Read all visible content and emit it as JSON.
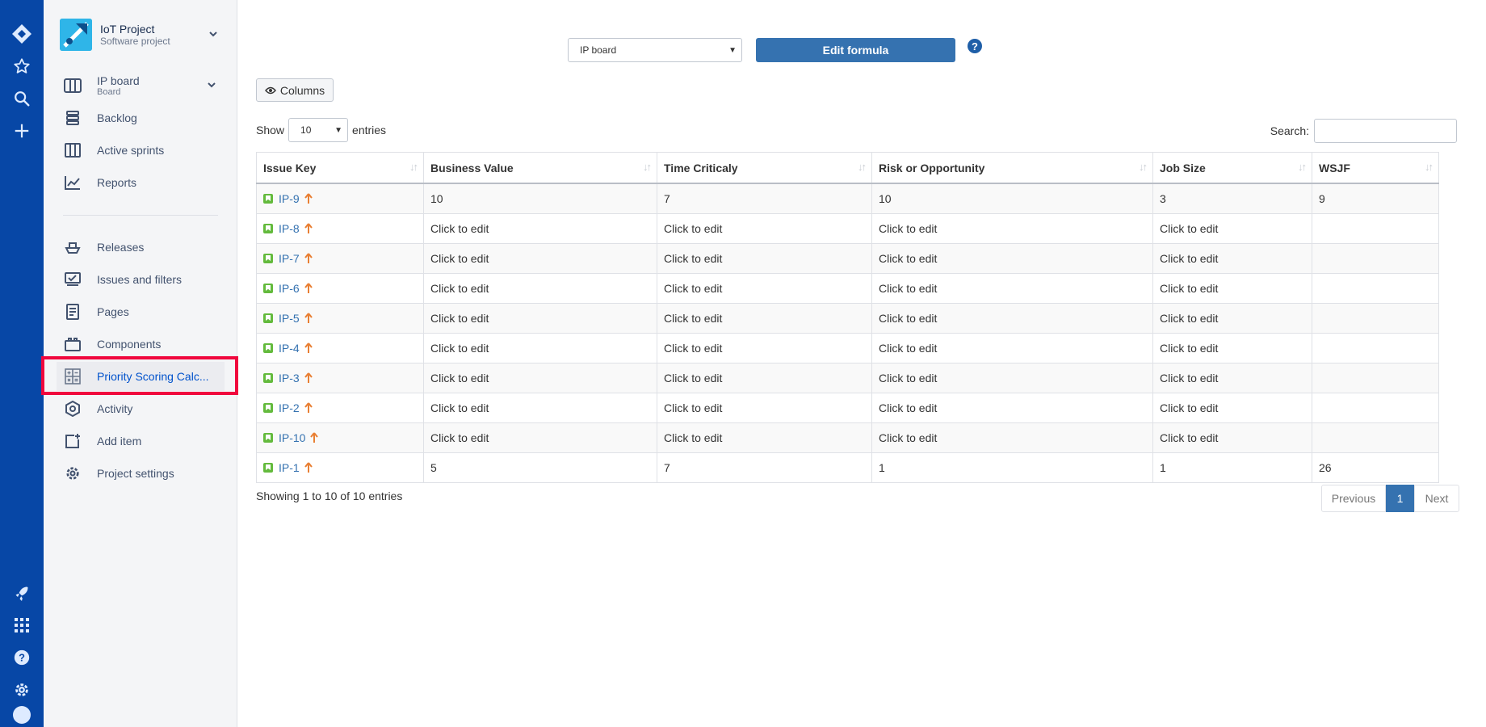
{
  "project": {
    "name": "IoT Project",
    "type": "Software project"
  },
  "sidebar": {
    "board": {
      "label": "IP board",
      "sub": "Board"
    },
    "planning": [
      {
        "label": "Backlog"
      },
      {
        "label": "Active sprints"
      },
      {
        "label": "Reports"
      }
    ],
    "items": [
      {
        "label": "Releases"
      },
      {
        "label": "Issues and filters"
      },
      {
        "label": "Pages"
      },
      {
        "label": "Components"
      },
      {
        "label": "Priority Scoring Calc..."
      },
      {
        "label": "Activity"
      },
      {
        "label": "Add item"
      },
      {
        "label": "Project settings"
      }
    ]
  },
  "toolbar": {
    "board_select": "IP board",
    "edit_formula": "Edit formula",
    "help": "?",
    "columns": "Columns"
  },
  "table_controls": {
    "show": "Show",
    "page_length": "10",
    "entries": "entries",
    "search_label": "Search:"
  },
  "table": {
    "headers": [
      "Issue Key",
      "Business Value",
      "Time Criticaly",
      "Risk or Opportunity",
      "Job Size",
      "WSJF"
    ],
    "rows": [
      {
        "key": "IP-9",
        "bv": "10",
        "tc": "7",
        "ro": "10",
        "js": "3",
        "wsjf": "9"
      },
      {
        "key": "IP-8",
        "bv": "Click to edit",
        "tc": "Click to edit",
        "ro": "Click to edit",
        "js": "Click to edit",
        "wsjf": ""
      },
      {
        "key": "IP-7",
        "bv": "Click to edit",
        "tc": "Click to edit",
        "ro": "Click to edit",
        "js": "Click to edit",
        "wsjf": ""
      },
      {
        "key": "IP-6",
        "bv": "Click to edit",
        "tc": "Click to edit",
        "ro": "Click to edit",
        "js": "Click to edit",
        "wsjf": ""
      },
      {
        "key": "IP-5",
        "bv": "Click to edit",
        "tc": "Click to edit",
        "ro": "Click to edit",
        "js": "Click to edit",
        "wsjf": ""
      },
      {
        "key": "IP-4",
        "bv": "Click to edit",
        "tc": "Click to edit",
        "ro": "Click to edit",
        "js": "Click to edit",
        "wsjf": ""
      },
      {
        "key": "IP-3",
        "bv": "Click to edit",
        "tc": "Click to edit",
        "ro": "Click to edit",
        "js": "Click to edit",
        "wsjf": ""
      },
      {
        "key": "IP-2",
        "bv": "Click to edit",
        "tc": "Click to edit",
        "ro": "Click to edit",
        "js": "Click to edit",
        "wsjf": ""
      },
      {
        "key": "IP-10",
        "bv": "Click to edit",
        "tc": "Click to edit",
        "ro": "Click to edit",
        "js": "Click to edit",
        "wsjf": ""
      },
      {
        "key": "IP-1",
        "bv": "5",
        "tc": "7",
        "ro": "1",
        "js": "1",
        "wsjf": "26"
      }
    ]
  },
  "footer": {
    "info": "Showing 1 to 10 of 10 entries",
    "previous": "Previous",
    "current_page": "1",
    "next": "Next"
  },
  "colors": {
    "rail": "#0747a6",
    "accent": "#3572b0",
    "highlight": "#f0073d",
    "story": "#63ba3c",
    "priority": "#e97f33"
  },
  "icons": {
    "rail_top": [
      "jira-logo-icon",
      "star-icon",
      "search-icon",
      "plus-icon"
    ],
    "rail_bottom": [
      "rocket-icon",
      "apps-grid-icon",
      "help-icon",
      "settings-icon"
    ]
  }
}
